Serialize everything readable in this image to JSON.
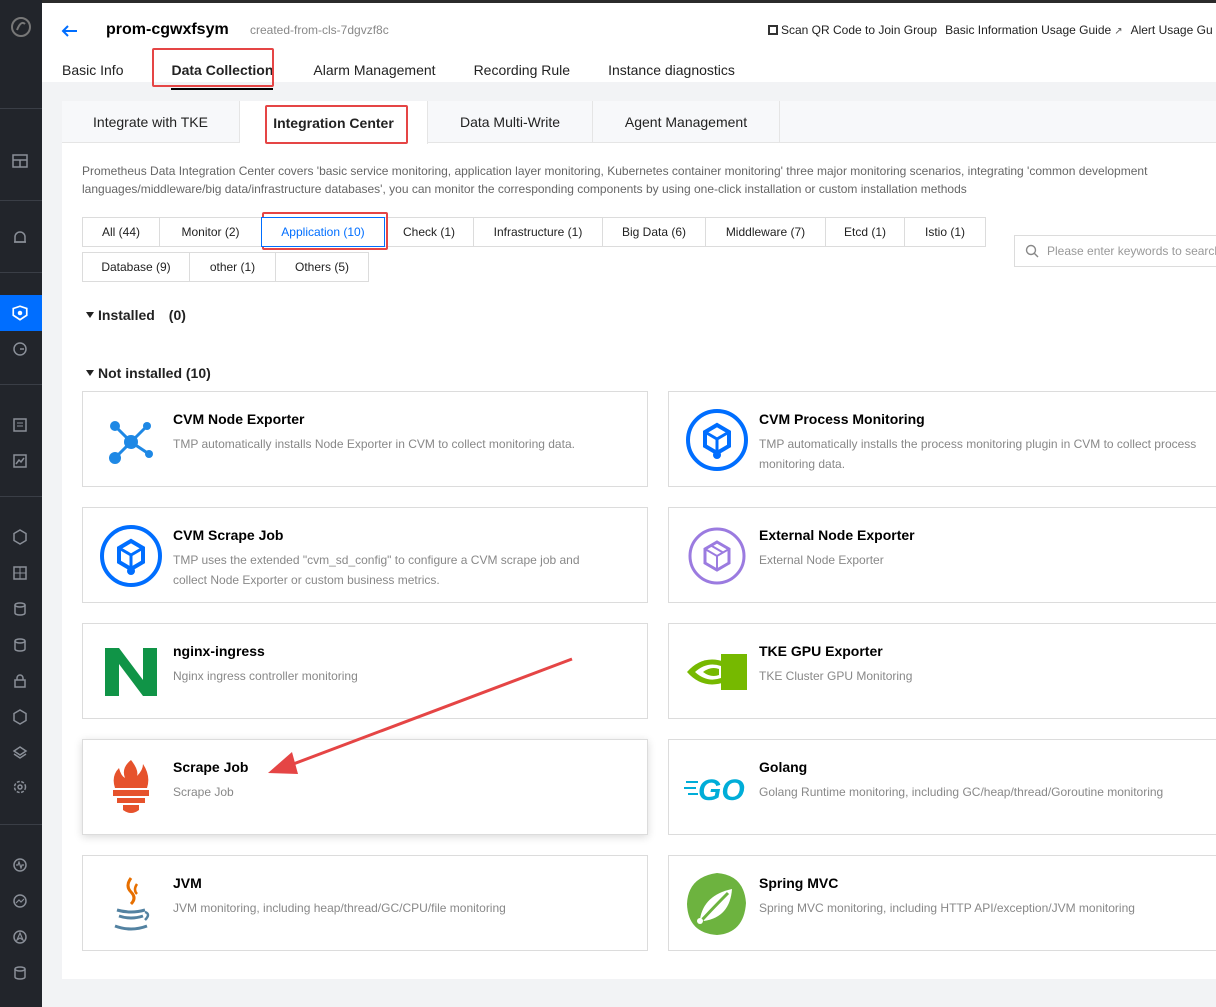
{
  "header": {
    "instance_name": "prom-cgwxfsym",
    "instance_sub": "created-from-cls-7dgvzf8c",
    "links": [
      {
        "label": "Scan QR Code to Join Group"
      },
      {
        "label": "Basic Information Usage Guide"
      },
      {
        "label": "Alert Usage Gu"
      }
    ]
  },
  "main_tabs": [
    "Basic Info",
    "Data Collection",
    "Alarm Management",
    "Recording Rule",
    "Instance diagnostics"
  ],
  "sub_tabs": [
    "Integrate with TKE",
    "Integration Center",
    "Data Multi-Write",
    "Agent Management"
  ],
  "description": "Prometheus Data Integration Center covers 'basic service monitoring, application layer monitoring, Kubernetes container monitoring' three major monitoring scenarios, integrating 'common development languages/middleware/big data/infrastructure databases', you can monitor the corresponding components by using one-click installation or custom installation methods",
  "filters_row1": [
    "All (44)",
    "Monitor (2)",
    "Application (10)",
    "Check (1)",
    "Infrastructure (1)",
    "Big Data (6)",
    "Middleware (7)",
    "Etcd (1)",
    "Istio (1)"
  ],
  "filters_row2": [
    "Database (9)",
    "other (1)",
    "Others (5)"
  ],
  "active_filter": "Application (10)",
  "search": {
    "placeholder": "Please enter keywords to search"
  },
  "installed": {
    "label": "Installed",
    "count": "(0)"
  },
  "not_installed": {
    "label": "Not installed (10)"
  },
  "cards": [
    {
      "title": "CVM Node Exporter",
      "desc": "TMP automatically installs Node Exporter in CVM to collect monitoring data."
    },
    {
      "title": "CVM Process Monitoring",
      "desc": "TMP automatically installs the process monitoring plugin in CVM to collect process monitoring data."
    },
    {
      "title": "CVM Scrape Job",
      "desc": "TMP uses the extended \"cvm_sd_config\" to configure a CVM scrape job and collect Node Exporter or custom business metrics."
    },
    {
      "title": "External Node Exporter",
      "desc": "External Node Exporter"
    },
    {
      "title": "nginx-ingress",
      "desc": "Nginx ingress controller monitoring"
    },
    {
      "title": "TKE GPU Exporter",
      "desc": "TKE Cluster GPU Monitoring"
    },
    {
      "title": "Scrape Job",
      "desc": "Scrape Job"
    },
    {
      "title": "Golang",
      "desc": "Golang Runtime monitoring, including GC/heap/thread/Goroutine monitoring"
    },
    {
      "title": "JVM",
      "desc": "JVM monitoring, including heap/thread/GC/CPU/file monitoring"
    },
    {
      "title": "Spring MVC",
      "desc": "Spring MVC monitoring, including HTTP API/exception/JVM monitoring"
    }
  ],
  "icon_labels": {
    "golang": "GO"
  },
  "colors": {
    "accent": "#006eff",
    "highlight": "#e54545",
    "rail": "#22252b"
  }
}
